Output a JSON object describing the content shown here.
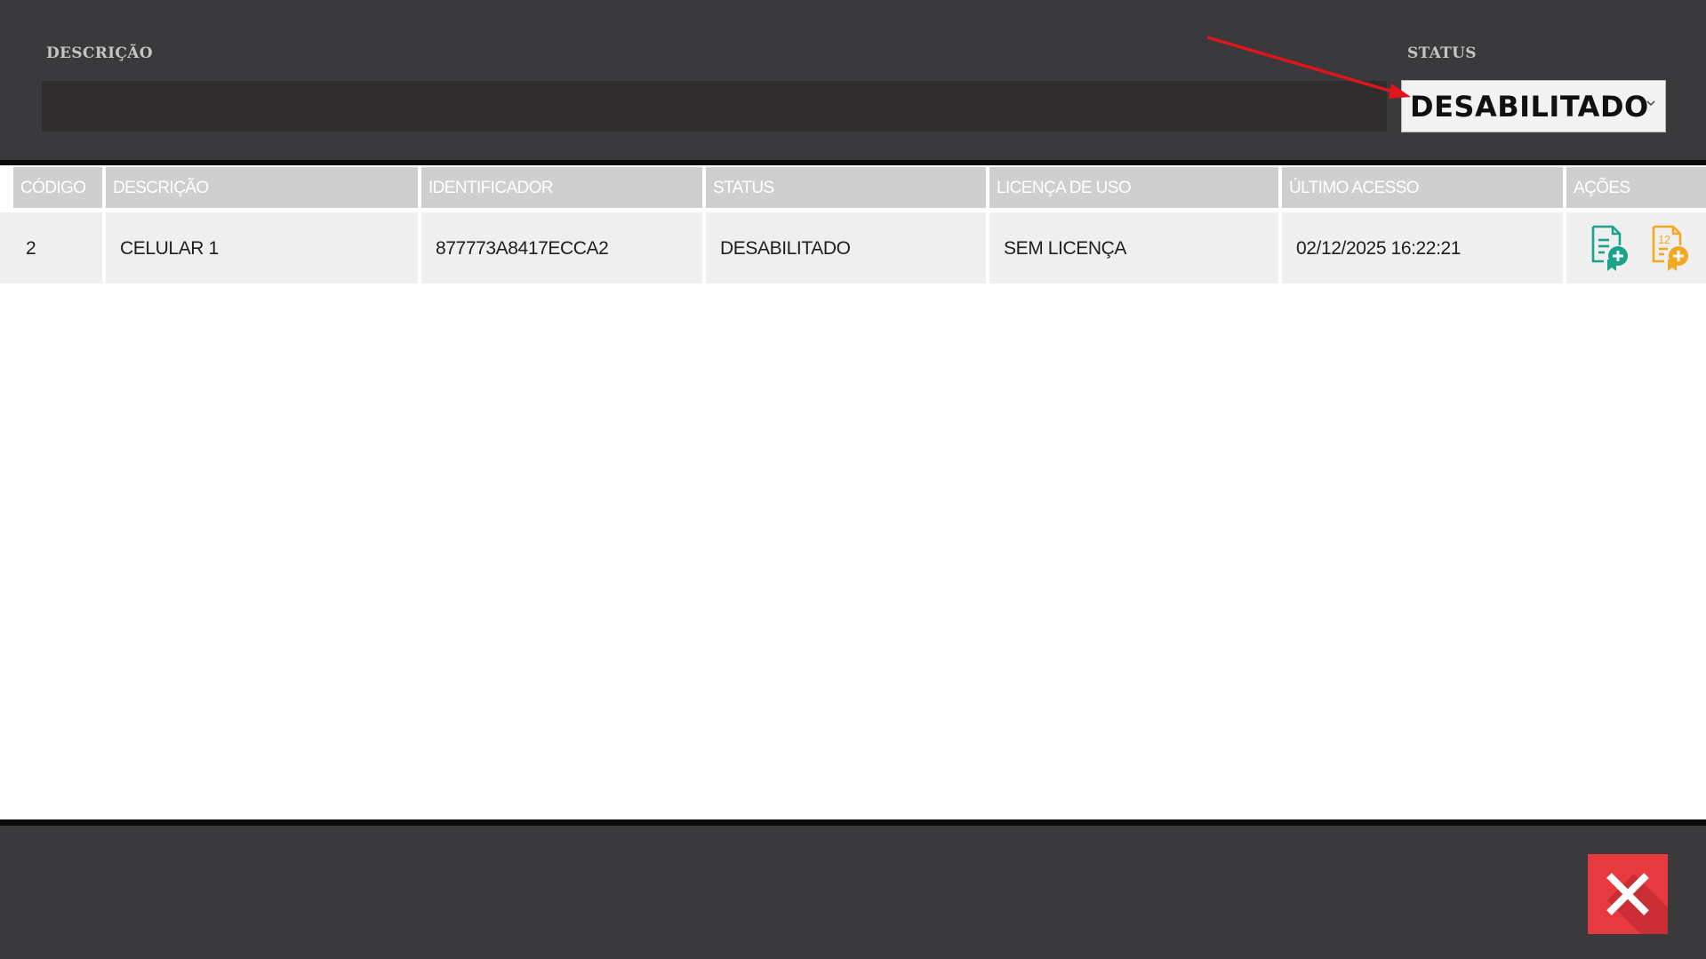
{
  "filter": {
    "description_label": "DESCRIÇÃO",
    "description_value": "",
    "status_label": "STATUS",
    "status_value": "DESABILITADO",
    "annotation_color": "#e0141b"
  },
  "table": {
    "headers": [
      "CÓDIGO",
      "DESCRIÇÃO",
      "IDENTIFICADOR",
      "STATUS",
      "LICENÇA DE USO",
      "ÚLTIMO ACESSO",
      "AÇÕES"
    ],
    "rows": [
      {
        "codigo": "2",
        "descricao": "CELULAR 1",
        "identificador": "877773A8417ECCA2",
        "status": "DESABILITADO",
        "licenca": "SEM LICENÇA",
        "ultimo_acesso": "02/12/2025 16:22:21",
        "actions": [
          {
            "icon": "certificate-add-icon",
            "color": "#1aa38c"
          },
          {
            "icon": "certificate-12-add-icon",
            "color": "#f2a91f",
            "badge": "12"
          }
        ]
      }
    ]
  },
  "footer": {
    "close_icon": "close-icon",
    "close_color": "#e8393f"
  }
}
